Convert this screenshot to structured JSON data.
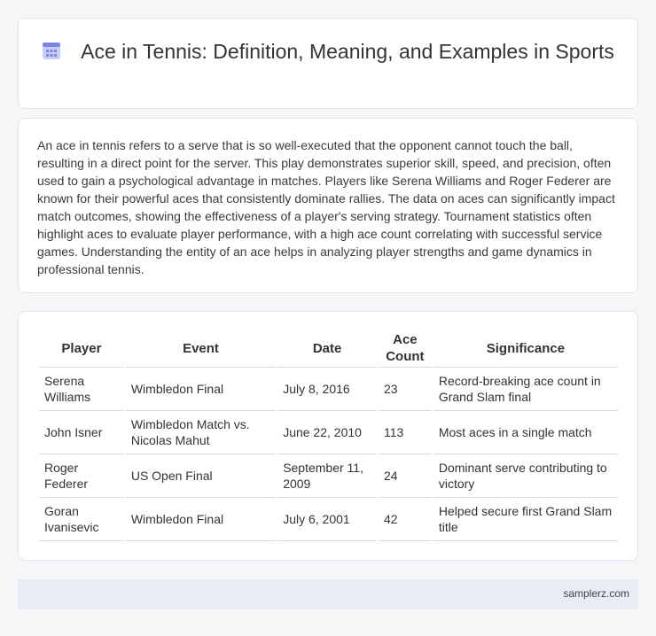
{
  "header": {
    "icon": "calendar-icon",
    "title": "Ace in Tennis: Definition, Meaning, and Examples in Sports"
  },
  "intro": {
    "text": "An ace in tennis refers to a serve that is so well-executed that the opponent cannot touch the ball, resulting in a direct point for the server. This play demonstrates superior skill, speed, and precision, often used to gain a psychological advantage in matches. Players like Serena Williams and Roger Federer are known for their powerful aces that consistently dominate rallies. The data on aces can significantly impact match outcomes, showing the effectiveness of a player's serving strategy. Tournament statistics often highlight aces to evaluate player performance, with a high ace count correlating with successful service games. Understanding the entity of an ace helps in analyzing player strengths and game dynamics in professional tennis."
  },
  "table": {
    "headers": [
      "Player",
      "Event",
      "Date",
      "Ace Count",
      "Significance"
    ],
    "rows": [
      [
        "Serena Williams",
        "Wimbledon Final",
        "July 8, 2016",
        "23",
        "Record-breaking ace count in Grand Slam final"
      ],
      [
        "John Isner",
        "Wimbledon Match vs. Nicolas Mahut",
        "June 22, 2010",
        "113",
        "Most aces in a single match"
      ],
      [
        "Roger Federer",
        "US Open Final",
        "September 11, 2009",
        "24",
        "Dominant serve contributing to victory"
      ],
      [
        "Goran Ivanisevic",
        "Wimbledon Final",
        "July 6, 2001",
        "42",
        "Helped secure first Grand Slam title"
      ]
    ]
  },
  "footer": {
    "text": "samplerz.com"
  },
  "colors": {
    "icon_accent": "#7b86e6",
    "icon_light": "#c9cdf6"
  }
}
